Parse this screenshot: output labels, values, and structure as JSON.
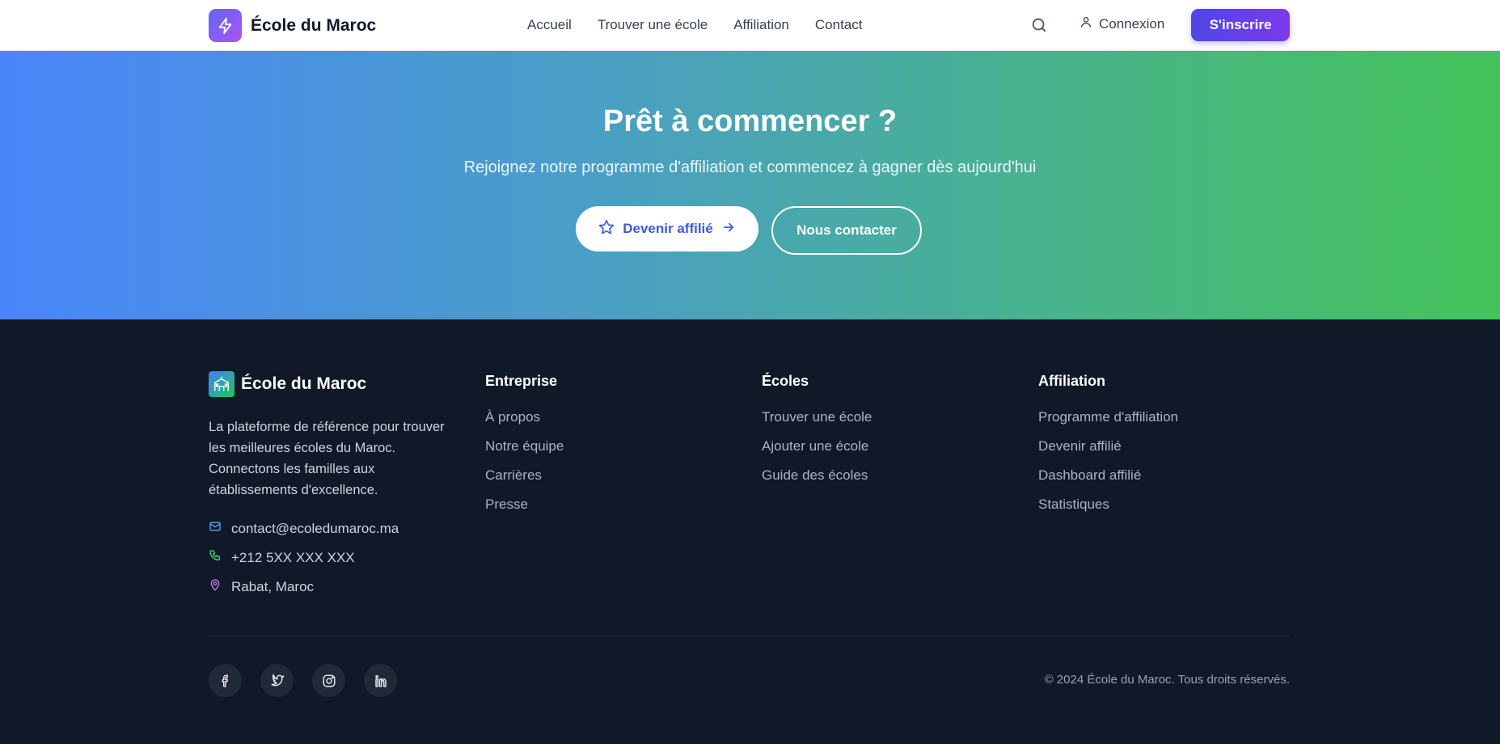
{
  "header": {
    "brand": "École du Maroc",
    "brand_icon": "lightning-icon",
    "nav": [
      "Accueil",
      "Trouver une école",
      "Affiliation",
      "Contact"
    ],
    "search_icon": "search-icon",
    "login_label": "Connexion",
    "signup_label": "S'inscrire"
  },
  "cta": {
    "title": "Prêt à commencer ?",
    "subtitle": "Rejoignez notre programme d'affiliation et commencez à gagner dès aujourd'hui",
    "primary_label": "Devenir affilié",
    "secondary_label": "Nous contacter",
    "gradient_start": "#4a86fb",
    "gradient_end": "#45c35a"
  },
  "footer": {
    "brand": "École du Maroc",
    "description": "La plateforme de référence pour trouver les meilleures écoles du Maroc. Connectons les familles aux établissements d'excellence.",
    "email": "contact@ecoledumaroc.ma",
    "phone": "+212 5XX XXX XXX",
    "location": "Rabat, Maroc",
    "columns": [
      {
        "title": "Entreprise",
        "links": [
          "À propos",
          "Notre équipe",
          "Carrières",
          "Presse"
        ]
      },
      {
        "title": "Écoles",
        "links": [
          "Trouver une école",
          "Ajouter une école",
          "Guide des écoles"
        ]
      },
      {
        "title": "Affiliation",
        "links": [
          "Programme d'affiliation",
          "Devenir affilié",
          "Dashboard affilié",
          "Statistiques"
        ]
      }
    ],
    "socials": [
      "facebook-icon",
      "twitter-icon",
      "instagram-icon",
      "linkedin-icon"
    ],
    "copyright": "© 2024 École du Maroc. Tous droits réservés."
  }
}
